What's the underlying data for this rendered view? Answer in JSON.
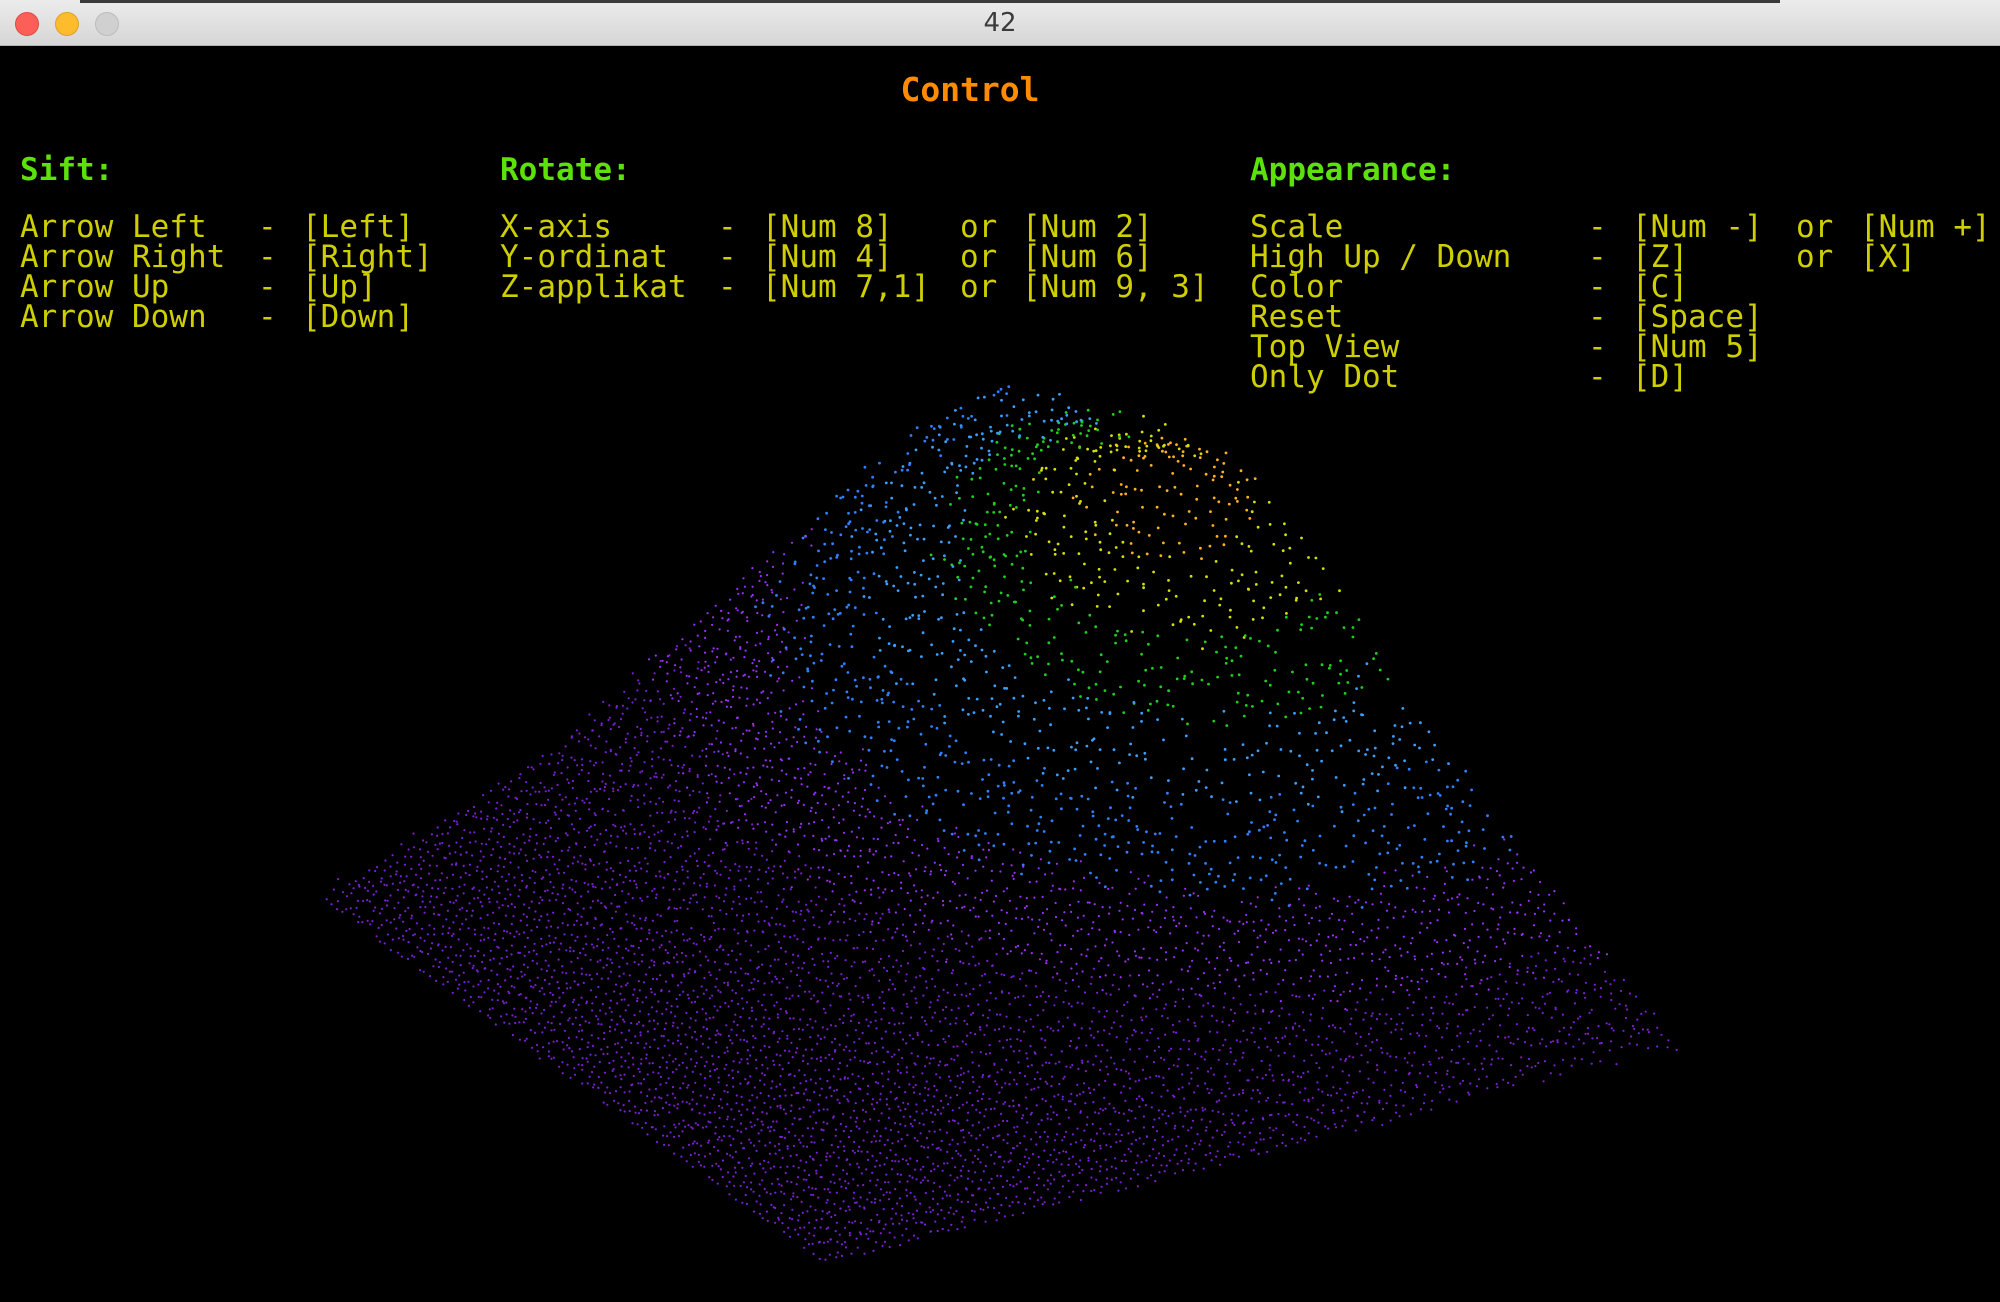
{
  "window": {
    "title": "42"
  },
  "control": {
    "title": "Control",
    "sections": [
      {
        "heading": "Sift:",
        "rows": [
          {
            "action": "Arrow Left",
            "sep": "-",
            "key": "[Left]"
          },
          {
            "action": "Arrow Right",
            "sep": "-",
            "key": "[Right]"
          },
          {
            "action": "Arrow Up",
            "sep": "-",
            "key": "[Up]"
          },
          {
            "action": "Arrow Down",
            "sep": "-",
            "key": "[Down]"
          }
        ]
      },
      {
        "heading": "Rotate:",
        "rows": [
          {
            "action": "X-axis",
            "sep": "-",
            "key": "[Num 8]",
            "or": "or",
            "alt": "[Num 2]"
          },
          {
            "action": "Y-ordinat",
            "sep": "-",
            "key": "[Num 4]",
            "or": "or",
            "alt": "[Num 6]"
          },
          {
            "action": "Z-applikat",
            "sep": "-",
            "key": "[Num 7,1]",
            "or": "or",
            "alt": "[Num 9, 3]"
          }
        ]
      },
      {
        "heading": "Appearance:",
        "rows": [
          {
            "action": "Scale",
            "sep": "-",
            "key": "[Num -]",
            "or": "or",
            "alt": "[Num +]"
          },
          {
            "action": "High Up / Down",
            "sep": "-",
            "key": "[Z]",
            "or": "or",
            "alt": "[X]"
          },
          {
            "action": "Color",
            "sep": "-",
            "key": "[C]"
          },
          {
            "action": "Reset",
            "sep": "-",
            "key": "[Space]"
          },
          {
            "action": "Top View",
            "sep": "-",
            "key": "[Num 5]"
          },
          {
            "action": "Only Dot",
            "sep": "-",
            "key": "[D]"
          }
        ]
      }
    ]
  },
  "colors": {
    "title": "#ff8c00",
    "heading": "#5ce10a",
    "text": "#cfcf00",
    "background": "#000000",
    "palette_low_to_high": [
      "#7a1fd6",
      "#9b30ff",
      "#2f7fff",
      "#3aa0ff",
      "#1fcf1f",
      "#d4e000",
      "#ffb020"
    ]
  },
  "visualization": {
    "kind": "3D point-cloud terrain (wireframe dots)"
  }
}
